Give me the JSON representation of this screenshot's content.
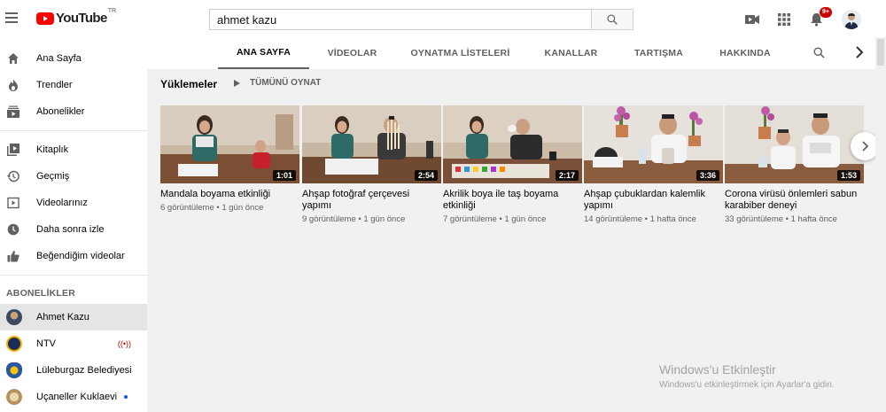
{
  "header": {
    "logo_text": "YouTube",
    "logo_country": "TR",
    "search_value": "ahmet kazu",
    "notification_count": "9+",
    "icons": [
      "menu-icon",
      "search-icon",
      "video-camera-icon",
      "apps-grid-icon",
      "bell-icon"
    ]
  },
  "sidebar": {
    "items": [
      {
        "label": "Ana Sayfa",
        "icon": "home-icon"
      },
      {
        "label": "Trendler",
        "icon": "flame-icon"
      },
      {
        "label": "Abonelikler",
        "icon": "subscriptions-icon"
      }
    ],
    "library_items": [
      {
        "label": "Kitaplık",
        "icon": "library-icon"
      },
      {
        "label": "Geçmiş",
        "icon": "history-icon"
      },
      {
        "label": "Videolarınız",
        "icon": "your-videos-icon"
      },
      {
        "label": "Daha sonra izle",
        "icon": "watch-later-icon"
      },
      {
        "label": "Beğendiğim videolar",
        "icon": "thumbs-up-icon"
      }
    ],
    "subscriptions_heading": "ABONELİKLER",
    "subscriptions": [
      {
        "label": "Ahmet Kazu",
        "active": true
      },
      {
        "label": "NTV",
        "live": true
      },
      {
        "label": "Lüleburgaz Belediyesi"
      },
      {
        "label": "Uçaneller Kuklaevi",
        "new": true
      }
    ]
  },
  "channel_tabs": [
    {
      "label": "ANA SAYFA",
      "active": true
    },
    {
      "label": "VİDEOLAR"
    },
    {
      "label": "OYNATMA LİSTELERİ"
    },
    {
      "label": "KANALLAR"
    },
    {
      "label": "TARTIŞMA"
    },
    {
      "label": "HAKKINDA"
    }
  ],
  "shelf": {
    "title": "Yüklemeler",
    "play_all": "TÜMÜNÜ OYNAT",
    "videos": [
      {
        "title": "Mandala boyama etkinliği",
        "meta": "6 görüntüleme • 1 gün önce",
        "duration": "1:01"
      },
      {
        "title": "Ahşap fotoğraf çerçevesi yapımı",
        "meta": "9 görüntüleme • 1 gün önce",
        "duration": "2:54"
      },
      {
        "title": "Akrilik boya ile taş boyama etkinliği",
        "meta": "7 görüntüleme • 1 gün önce",
        "duration": "2:17"
      },
      {
        "title": "Ahşap çubuklardan kalemlik yapımı",
        "meta": "14 görüntüleme • 1 hafta önce",
        "duration": "3:36"
      },
      {
        "title": "Corona virüsü önlemleri sabun karabiber deneyi",
        "meta": "33 görüntüleme • 1 hafta önce",
        "duration": "1:53"
      }
    ]
  },
  "watermark": {
    "title": "Windows'u Etkinleştir",
    "subtitle": "Windows'u etkinleştirmek için Ayarlar'a gidin."
  }
}
